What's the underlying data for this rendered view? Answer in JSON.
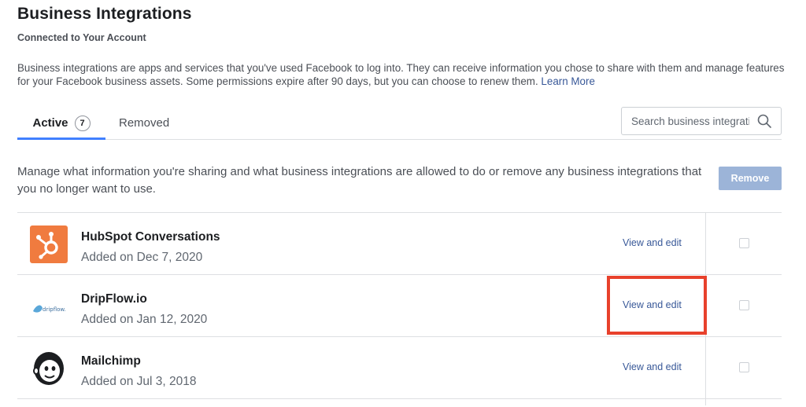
{
  "header": {
    "title": "Business Integrations",
    "subtitle": "Connected to Your Account",
    "description": "Business integrations are apps and services that you've used Facebook to log into. They can receive information you chose to share with them and manage features for your Facebook business assets. Some permissions expire after 90 days, but you can choose to renew them.",
    "learn_more": "Learn More"
  },
  "tabs": [
    {
      "label": "Active",
      "count": "7",
      "active": true
    },
    {
      "label": "Removed",
      "active": false
    }
  ],
  "search": {
    "placeholder": "Search business integrations",
    "value": ""
  },
  "manage": {
    "text": "Manage what information you're sharing and what business integrations are allowed to do or remove any business integrations that you no longer want to use.",
    "remove_label": "Remove"
  },
  "integrations": [
    {
      "name": "HubSpot Conversations",
      "added": "Added on Dec 7, 2020",
      "action": "View and edit",
      "logo": "hubspot-logo",
      "checked": false
    },
    {
      "name": "DripFlow.io",
      "added": "Added on Jan 12, 2020",
      "action": "View and edit",
      "logo": "dripflow-logo",
      "logo_text": "dripflow.",
      "checked": false
    },
    {
      "name": "Mailchimp",
      "added": "Added on Jul 3, 2018",
      "action": "View and edit",
      "logo": "mailchimp-logo",
      "checked": false
    }
  ],
  "colors": {
    "accent": "#4080ff",
    "link": "#385898",
    "remove_button": "#9cb4d8",
    "highlight": "#e8412c",
    "hubspot": "#f07b3f"
  }
}
